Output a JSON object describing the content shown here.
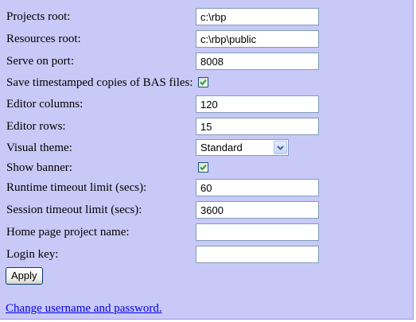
{
  "form": {
    "projects_root": {
      "label": "Projects root:",
      "value": "c:\\rbp"
    },
    "resources_root": {
      "label": "Resources root:",
      "value": "c:\\rbp\\public"
    },
    "serve_on_port": {
      "label": "Serve on port:",
      "value": "8008"
    },
    "save_timestamped": {
      "label": "Save timestamped copies of BAS files:",
      "checked": true
    },
    "editor_columns": {
      "label": "Editor columns:",
      "value": "120"
    },
    "editor_rows": {
      "label": "Editor rows:",
      "value": "15"
    },
    "visual_theme": {
      "label": "Visual theme:",
      "value": "Standard"
    },
    "show_banner": {
      "label": "Show banner:",
      "checked": true
    },
    "runtime_timeout": {
      "label": "Runtime timeout limit (secs):",
      "value": "60"
    },
    "session_timeout": {
      "label": "Session timeout limit (secs):",
      "value": "3600"
    },
    "home_page_project": {
      "label": "Home page project name:",
      "value": ""
    },
    "login_key": {
      "label": "Login key:",
      "value": ""
    }
  },
  "actions": {
    "apply_label": "Apply",
    "change_credentials_link": "Change username and password."
  },
  "colors": {
    "background": "#c9c9f7",
    "link": "#0000ee",
    "checkmark": "#21a121",
    "input_border": "#7f9db9"
  }
}
